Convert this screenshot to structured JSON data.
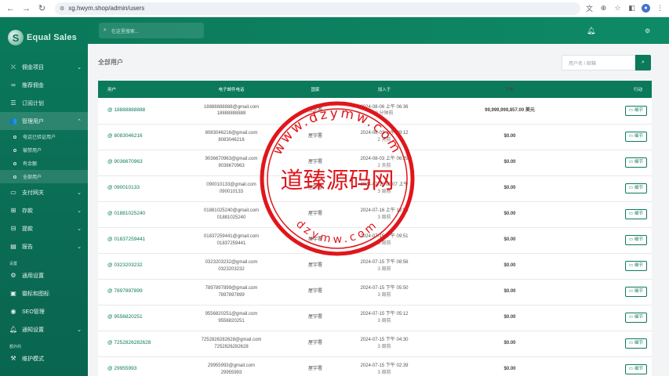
{
  "browser": {
    "url": "xg.hwym.shop/admin/users"
  },
  "sidebar": {
    "brand": "Equal Sales",
    "items": [
      {
        "label": "佣金项目",
        "icon": "grid-icon",
        "chevron": true
      },
      {
        "label": "推荐佣金",
        "icon": "link-icon",
        "chevron": false
      },
      {
        "label": "订阅计划",
        "icon": "list-icon",
        "chevron": false
      },
      {
        "label": "管理用户",
        "icon": "users-icon",
        "chevron": true,
        "open": true
      }
    ],
    "subitems": [
      {
        "label": "电话已验证用户"
      },
      {
        "label": "被禁用户"
      },
      {
        "label": "有余额"
      },
      {
        "label": "全部用户",
        "active": true
      }
    ],
    "items2": [
      {
        "label": "支付网关",
        "icon": "card-icon",
        "chevron": true
      },
      {
        "label": "存款",
        "icon": "deposit-icon",
        "chevron": true
      },
      {
        "label": "提款",
        "icon": "withdraw-icon",
        "chevron": true
      },
      {
        "label": "报告",
        "icon": "report-icon",
        "chevron": true
      }
    ],
    "section_settings": "设置",
    "items3": [
      {
        "label": "通用设置",
        "icon": "gear-icon"
      },
      {
        "label": "徽标和图标",
        "icon": "image-icon"
      },
      {
        "label": "SEO管理",
        "icon": "globe-icon"
      },
      {
        "label": "通知设置",
        "icon": "bell-icon",
        "chevron": true
      }
    ],
    "section_extra": "额外的",
    "items4": [
      {
        "label": "维护模式",
        "icon": "maintenance-icon"
      }
    ]
  },
  "topbar": {
    "search_placeholder": "在这里搜索..."
  },
  "page": {
    "title": "全部用户",
    "search_placeholder": "用户名 / 邮箱"
  },
  "table": {
    "headers": {
      "user": "用户",
      "email": "电子邮件电话",
      "country": "国家",
      "joined": "加入于",
      "balance": "平衡",
      "action": "行动"
    },
    "rows": [
      {
        "user": "@ 18888888888",
        "email": "18888888888@gmail.com",
        "phone": "18888888888",
        "country": "屋宇署",
        "joined": "2024-08-06 上午 06:36",
        "ago": "9 分钟前",
        "balance": "99,999,999,857.00 美元",
        "action": "细节"
      },
      {
        "user": "@ 8083046216",
        "email": "8083046216@gmail.com",
        "phone": "8083046216",
        "country": "屋宇署",
        "joined": "2024-08-03 上午 09:12",
        "ago": "2 天前",
        "balance": "$0.00",
        "action": "细节"
      },
      {
        "user": "@ 9036670963",
        "email": "9036670963@gmail.com",
        "phone": "9036670963",
        "country": "屋宇署",
        "joined": "2024-08-03 上午 06:29",
        "ago": "2 天前",
        "balance": "$0.00",
        "action": "细节"
      },
      {
        "user": "@ 090010133",
        "email": "090010133@gmail.com",
        "phone": "090010133",
        "country": "屋宇署",
        "joined": "2024-07-16 01:07 上午",
        "ago": "3 周前",
        "balance": "$0.00",
        "action": "细节"
      },
      {
        "user": "@ 01881025240",
        "email": "01881025240@gmail.com",
        "phone": "01881025240",
        "country": "屋宇署",
        "joined": "2024-07-16 上午 12:53",
        "ago": "3 周前",
        "balance": "$0.00",
        "action": "细节"
      },
      {
        "user": "@ 01837259441",
        "email": "01837259441@gmail.com",
        "phone": "01837259441",
        "country": "屋宇署",
        "joined": "2024-07-15 下午 09:51",
        "ago": "3 周前",
        "balance": "$0.00",
        "action": "细节"
      },
      {
        "user": "@ 0323203232",
        "email": "0323203232@gmail.com",
        "phone": "0323203232",
        "country": "屋宇署",
        "joined": "2024-07-15 下午 08:56",
        "ago": "3 周前",
        "balance": "$0.00",
        "action": "细节"
      },
      {
        "user": "@ 7897897899",
        "email": "7897897899@gmail.com",
        "phone": "7897897899",
        "country": "屋宇署",
        "joined": "2024-07-15 下午 05:50",
        "ago": "3 周前",
        "balance": "$0.00",
        "action": "细节"
      },
      {
        "user": "@ 9556820251",
        "email": "9556820251@gmail.com",
        "phone": "9556820251",
        "country": "屋宇署",
        "joined": "2024-07-15 下午 05:12",
        "ago": "3 周前",
        "balance": "$0.00",
        "action": "细节"
      },
      {
        "user": "@ 7252826282628",
        "email": "7252826282628@gmail.com",
        "phone": "7252826282628",
        "country": "屋宇署",
        "joined": "2024-07-15 下午 04:30",
        "ago": "3 周前",
        "balance": "$0.00",
        "action": "细节"
      },
      {
        "user": "@ 29955993",
        "email": "29955993@gmail.com",
        "phone": "29955993",
        "country": "屋宇署",
        "joined": "2024-07-15 下午 02:39",
        "ago": "3 周前",
        "balance": "$0.00",
        "action": "细节"
      }
    ]
  },
  "watermark": {
    "center_text": "道臻源码网",
    "ring_text": "dzymw.com",
    "ring_text_2": "www.dzymw.com",
    "color": "#e0161b"
  },
  "colors": {
    "brand": "#0b7a5b",
    "stamp": "#e0161b"
  }
}
